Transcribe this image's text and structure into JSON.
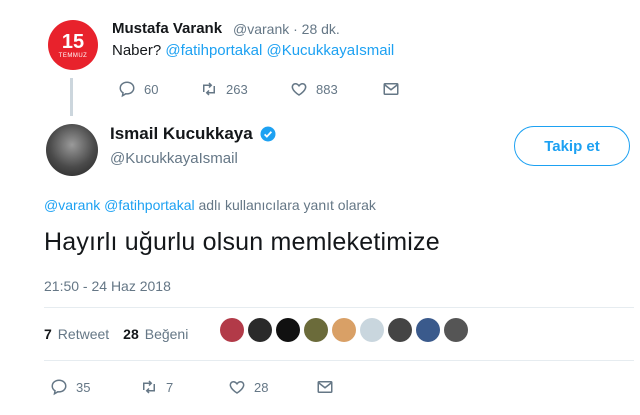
{
  "parent_tweet": {
    "name": "Mustafa Varank",
    "handle_time": "@varank · 28 dk.",
    "text_prefix": "Naber? ",
    "mentions": "@fatihportakal @KucukkayaIsmail",
    "avatar_big": "15",
    "avatar_small": "TEMMUZ",
    "replies": "60",
    "retweets": "263",
    "likes": "883"
  },
  "tweet": {
    "name": "Ismail Kucukkaya",
    "handle": "@KucukkayaIsmail",
    "follow_label": "Takip et",
    "reply_mentions": "@varank @fatihportakal",
    "reply_suffix": " adlı kullanıcılara yanıt olarak",
    "text": "Hayırlı uğurlu olsun memleketimize",
    "date": "21:50 - 24 Haz 2018",
    "retweet_count": "7",
    "retweet_label": "Retweet",
    "like_count": "28",
    "like_label": "Beğeni",
    "replies": "35",
    "retweets": "7",
    "likes": "28"
  },
  "likers": [
    "#b23a48",
    "#2a2a2a",
    "#111111",
    "#6b6b3a",
    "#d9a066",
    "#c9d6de",
    "#444444",
    "#3a5a8c",
    "#555555"
  ],
  "colors": {
    "accent": "#1da1f2",
    "muted": "#657786",
    "text": "#14171a"
  },
  "icons": [
    "reply-icon",
    "retweet-icon",
    "heart-icon",
    "message-icon",
    "verified-icon"
  ]
}
